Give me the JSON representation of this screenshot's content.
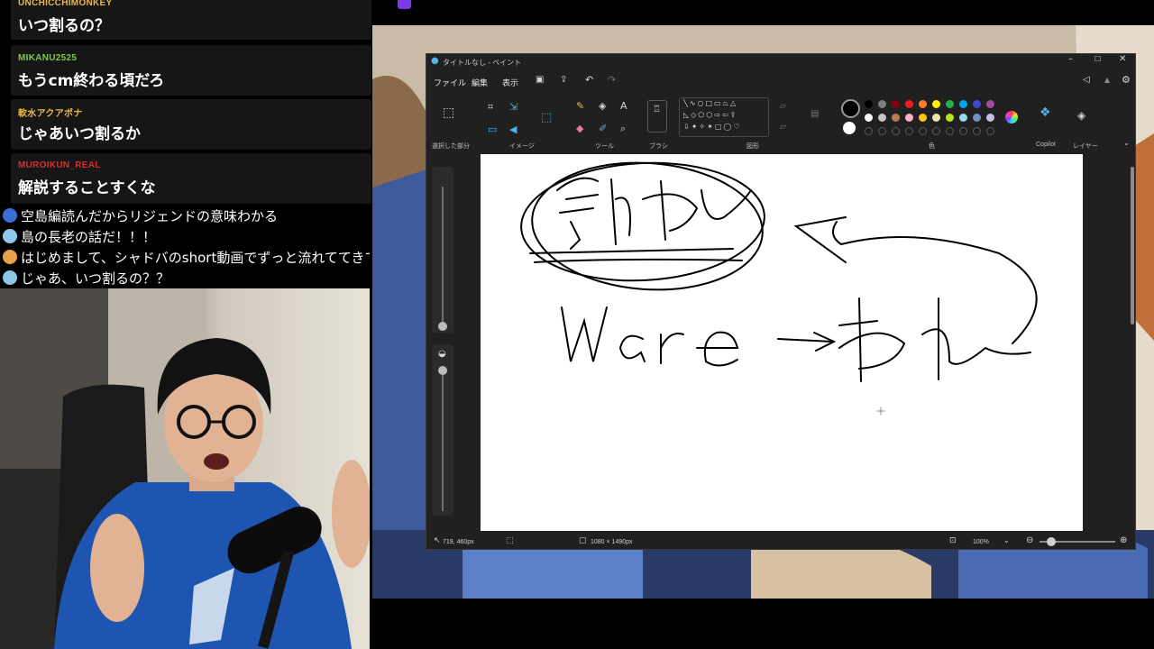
{
  "chat": {
    "messages": [
      {
        "user": "UNCHICCHIMONKEY",
        "text": "いつ割るの？",
        "color": "#e8b84a"
      },
      {
        "user": "MIKANU2525",
        "text": "もうcm終わる頃だろ",
        "color": "#7fc94a"
      },
      {
        "user": "軟水アクアポナ",
        "text": "じゃあいつ割るか",
        "color": "#e8b84a"
      },
      {
        "user": "MUROIKUN_REAL",
        "text": "解説することすくな",
        "color": "#d62f2f"
      }
    ]
  },
  "livechat": {
    "lines": [
      {
        "text": "空島編読んだからリジェンドの意味わかる",
        "icon_color": "#3a6fd8"
      },
      {
        "text": "島の長老の話だ！！！",
        "icon_color": "#8fc7e8"
      },
      {
        "text": "はじめまして、シャドバのshort動画でずっと流れててきて",
        "icon_color": "#e8a14a"
      },
      {
        "text": "じゃあ、いつ割るの？？",
        "icon_color": "#8fc7e8"
      }
    ]
  },
  "paint": {
    "title": "タイトルなし - ペイント",
    "menu": {
      "file": "ファイル",
      "edit": "編集",
      "view": "表示"
    },
    "groups": {
      "selection": "選択した部分",
      "image": "イメージ",
      "tools": "ツール",
      "brush": "ブラシ",
      "shapes": "図形",
      "colors": "色",
      "copilot": "Copilot",
      "layers": "レイヤー"
    },
    "status": {
      "cursor": "719, 460px",
      "canvas_size": "1080 × 1490px",
      "zoom": "100%"
    },
    "palette_row1": [
      "#000000",
      "#7f7f7f",
      "#880015",
      "#ed1c24",
      "#ff7f27",
      "#fff200",
      "#22b14c",
      "#00a2e8",
      "#3f48cc",
      "#a349a4"
    ],
    "palette_row2": [
      "#ffffff",
      "#c3c3c3",
      "#b97a57",
      "#ffaec9",
      "#ffc90e",
      "#efe4b0",
      "#b5e61d",
      "#99d9ea",
      "#7092be",
      "#c8bfe7"
    ],
    "drawing_text": "Ware→われ"
  }
}
